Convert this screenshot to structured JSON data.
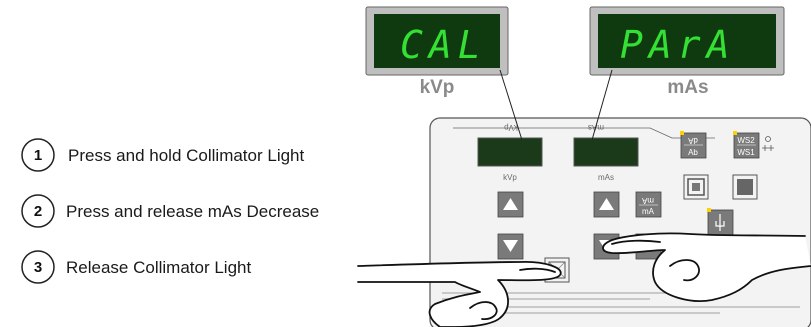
{
  "steps": [
    {
      "number": "1",
      "text": "Press and hold Collimator Light"
    },
    {
      "number": "2",
      "text": "Press and release mAs Decrease"
    },
    {
      "number": "3",
      "text": "Release Collimator Light"
    }
  ],
  "displays": {
    "left": {
      "text": "CAL",
      "label": "kVp"
    },
    "right": {
      "text": "PArA",
      "label": "mAs"
    }
  },
  "panel": {
    "top_left_label": "kVp",
    "top_right_label": "mAs",
    "kvp_label": "kVp",
    "mas_label": "mAs",
    "ab_top": "dA",
    "ab_bottom": "Ab",
    "ma_top": "mA",
    "ma_bottom": "mA",
    "ws2": "WS2",
    "ws1": "WS1"
  },
  "colors": {
    "display_bg": "#0f3a0f",
    "segment": "#35e035",
    "panel_bg": "#f3f3f3",
    "button": "#7a7a7a",
    "indicator": "#ffd200"
  }
}
